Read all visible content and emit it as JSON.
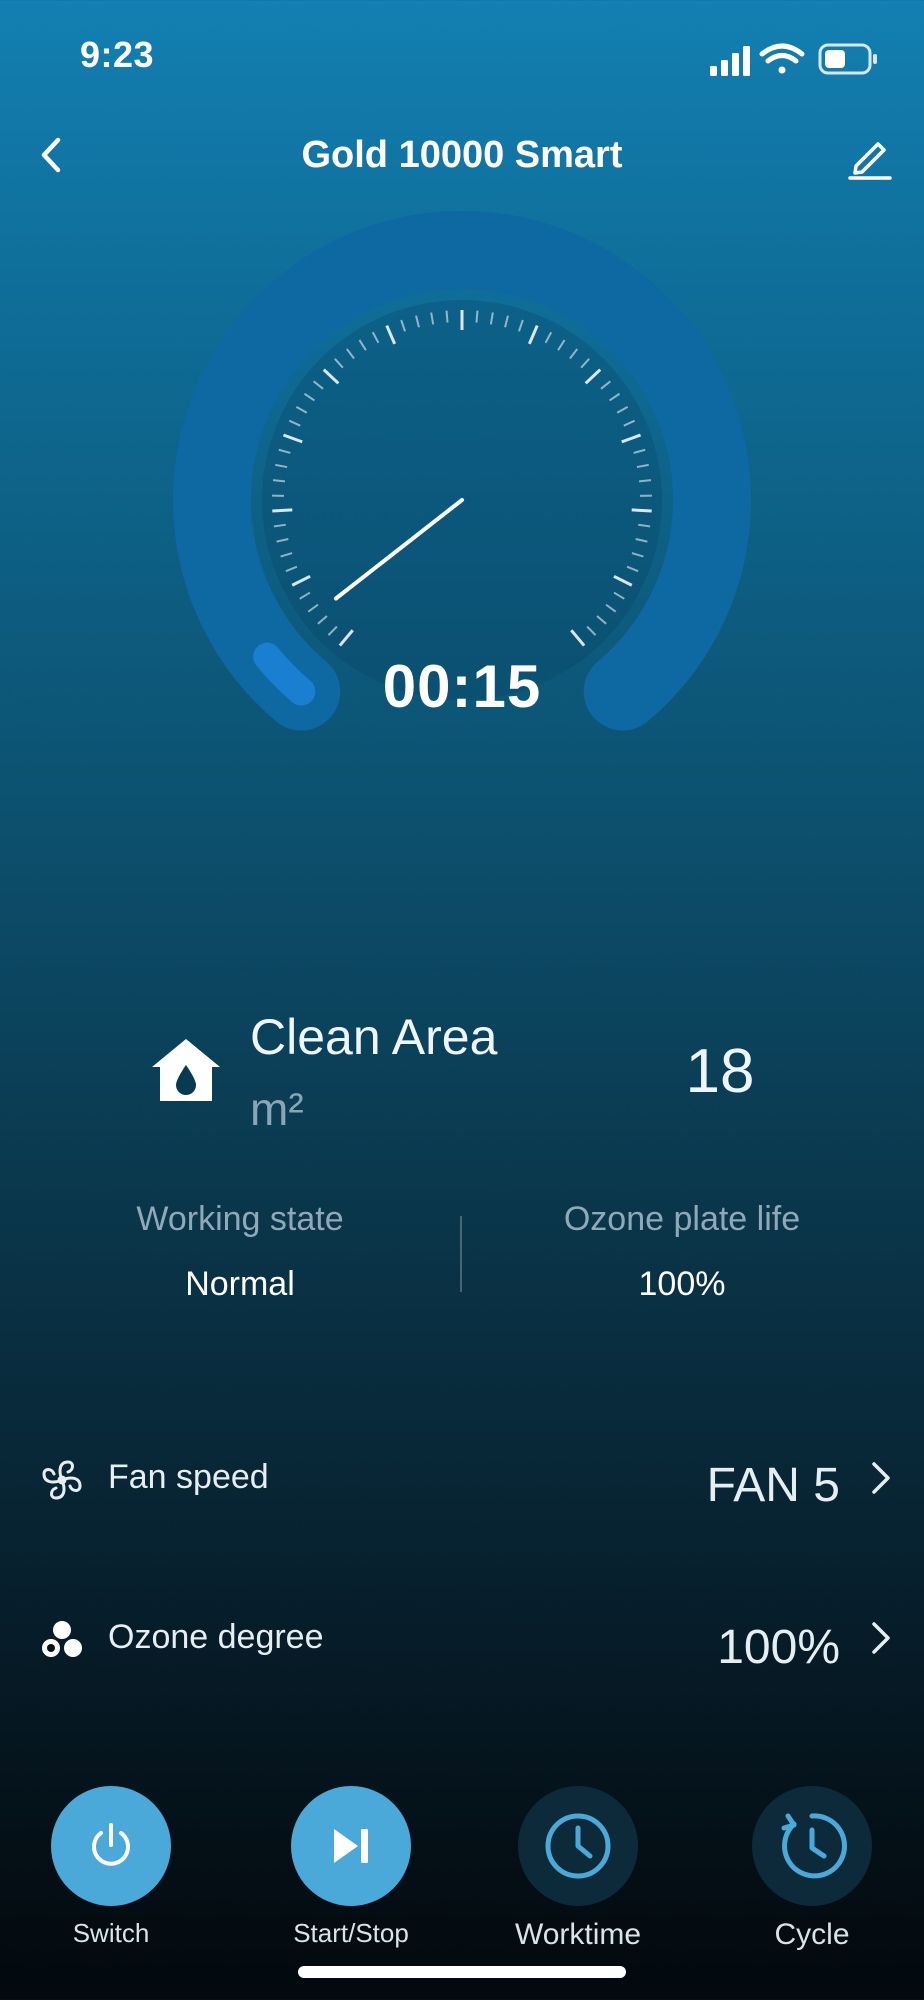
{
  "status_bar": {
    "time": "9:23"
  },
  "nav": {
    "title": "Gold 10000 Smart"
  },
  "dial": {
    "timer": "00:15",
    "progress_fraction": 0.04
  },
  "clean_area": {
    "label": "Clean Area",
    "unit": "m²",
    "value": "18"
  },
  "stats": [
    {
      "label": "Working state",
      "value": "Normal"
    },
    {
      "label": "Ozone plate life",
      "value": "100%"
    }
  ],
  "settings": [
    {
      "label": "Fan speed",
      "value": "FAN 5",
      "icon": "fan-icon"
    },
    {
      "label": "Ozone degree",
      "value": "100%",
      "icon": "ozone-icon"
    }
  ],
  "bottom_bar": [
    {
      "label": "Switch",
      "icon": "power-icon"
    },
    {
      "label": "Start/Stop",
      "icon": "play-pause-icon"
    },
    {
      "label": "Worktime",
      "icon": "clock-icon"
    },
    {
      "label": "Cycle",
      "icon": "cycle-clock-icon"
    }
  ],
  "colors": {
    "accent": "#4aa9d9",
    "dial_track": "#0e68a2",
    "dial_fill": "#1a7fd0",
    "inactive_button": "#0d2a3a"
  }
}
